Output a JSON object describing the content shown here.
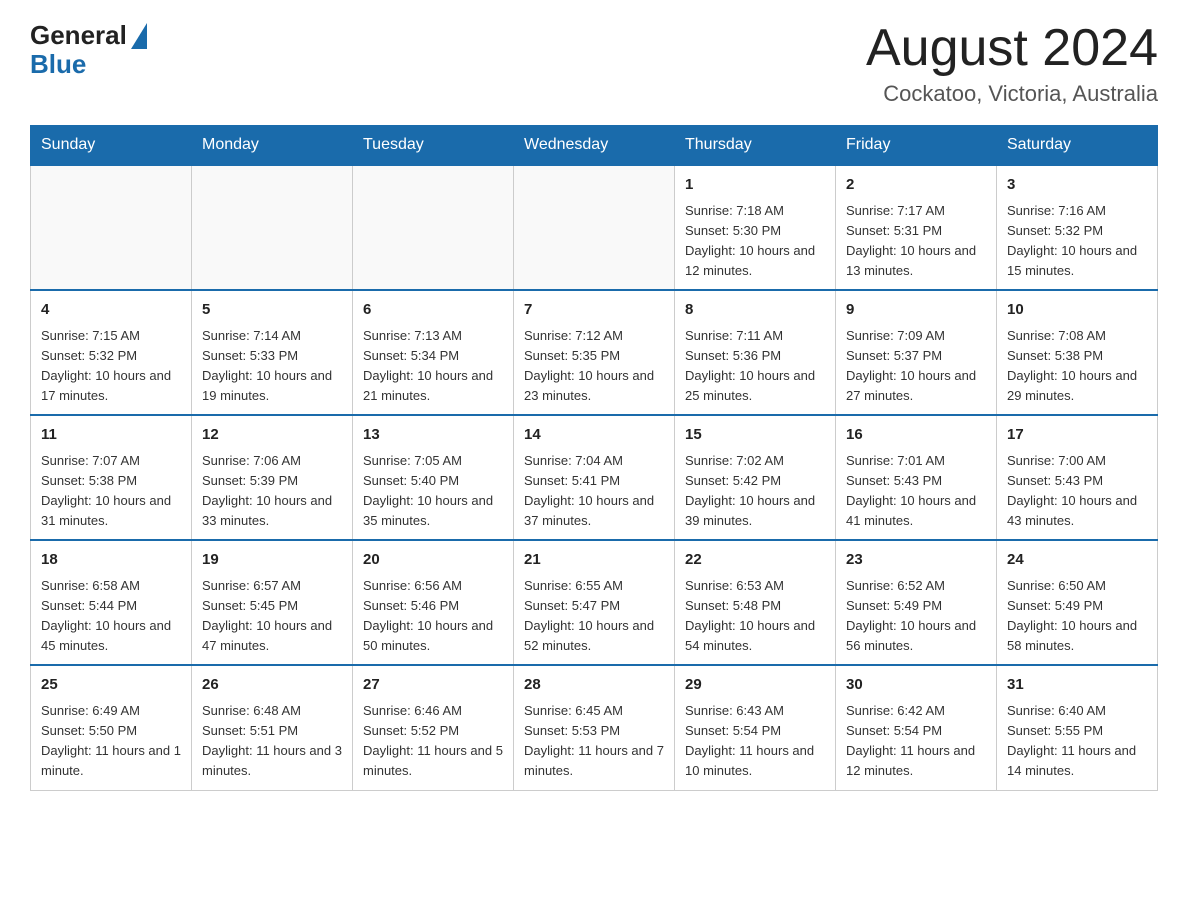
{
  "header": {
    "logo_general": "General",
    "logo_blue": "Blue",
    "month_title": "August 2024",
    "location": "Cockatoo, Victoria, Australia"
  },
  "calendar": {
    "days_of_week": [
      "Sunday",
      "Monday",
      "Tuesday",
      "Wednesday",
      "Thursday",
      "Friday",
      "Saturday"
    ],
    "weeks": [
      [
        {
          "day": "",
          "info": ""
        },
        {
          "day": "",
          "info": ""
        },
        {
          "day": "",
          "info": ""
        },
        {
          "day": "",
          "info": ""
        },
        {
          "day": "1",
          "info": "Sunrise: 7:18 AM\nSunset: 5:30 PM\nDaylight: 10 hours and 12 minutes."
        },
        {
          "day": "2",
          "info": "Sunrise: 7:17 AM\nSunset: 5:31 PM\nDaylight: 10 hours and 13 minutes."
        },
        {
          "day": "3",
          "info": "Sunrise: 7:16 AM\nSunset: 5:32 PM\nDaylight: 10 hours and 15 minutes."
        }
      ],
      [
        {
          "day": "4",
          "info": "Sunrise: 7:15 AM\nSunset: 5:32 PM\nDaylight: 10 hours and 17 minutes."
        },
        {
          "day": "5",
          "info": "Sunrise: 7:14 AM\nSunset: 5:33 PM\nDaylight: 10 hours and 19 minutes."
        },
        {
          "day": "6",
          "info": "Sunrise: 7:13 AM\nSunset: 5:34 PM\nDaylight: 10 hours and 21 minutes."
        },
        {
          "day": "7",
          "info": "Sunrise: 7:12 AM\nSunset: 5:35 PM\nDaylight: 10 hours and 23 minutes."
        },
        {
          "day": "8",
          "info": "Sunrise: 7:11 AM\nSunset: 5:36 PM\nDaylight: 10 hours and 25 minutes."
        },
        {
          "day": "9",
          "info": "Sunrise: 7:09 AM\nSunset: 5:37 PM\nDaylight: 10 hours and 27 minutes."
        },
        {
          "day": "10",
          "info": "Sunrise: 7:08 AM\nSunset: 5:38 PM\nDaylight: 10 hours and 29 minutes."
        }
      ],
      [
        {
          "day": "11",
          "info": "Sunrise: 7:07 AM\nSunset: 5:38 PM\nDaylight: 10 hours and 31 minutes."
        },
        {
          "day": "12",
          "info": "Sunrise: 7:06 AM\nSunset: 5:39 PM\nDaylight: 10 hours and 33 minutes."
        },
        {
          "day": "13",
          "info": "Sunrise: 7:05 AM\nSunset: 5:40 PM\nDaylight: 10 hours and 35 minutes."
        },
        {
          "day": "14",
          "info": "Sunrise: 7:04 AM\nSunset: 5:41 PM\nDaylight: 10 hours and 37 minutes."
        },
        {
          "day": "15",
          "info": "Sunrise: 7:02 AM\nSunset: 5:42 PM\nDaylight: 10 hours and 39 minutes."
        },
        {
          "day": "16",
          "info": "Sunrise: 7:01 AM\nSunset: 5:43 PM\nDaylight: 10 hours and 41 minutes."
        },
        {
          "day": "17",
          "info": "Sunrise: 7:00 AM\nSunset: 5:43 PM\nDaylight: 10 hours and 43 minutes."
        }
      ],
      [
        {
          "day": "18",
          "info": "Sunrise: 6:58 AM\nSunset: 5:44 PM\nDaylight: 10 hours and 45 minutes."
        },
        {
          "day": "19",
          "info": "Sunrise: 6:57 AM\nSunset: 5:45 PM\nDaylight: 10 hours and 47 minutes."
        },
        {
          "day": "20",
          "info": "Sunrise: 6:56 AM\nSunset: 5:46 PM\nDaylight: 10 hours and 50 minutes."
        },
        {
          "day": "21",
          "info": "Sunrise: 6:55 AM\nSunset: 5:47 PM\nDaylight: 10 hours and 52 minutes."
        },
        {
          "day": "22",
          "info": "Sunrise: 6:53 AM\nSunset: 5:48 PM\nDaylight: 10 hours and 54 minutes."
        },
        {
          "day": "23",
          "info": "Sunrise: 6:52 AM\nSunset: 5:49 PM\nDaylight: 10 hours and 56 minutes."
        },
        {
          "day": "24",
          "info": "Sunrise: 6:50 AM\nSunset: 5:49 PM\nDaylight: 10 hours and 58 minutes."
        }
      ],
      [
        {
          "day": "25",
          "info": "Sunrise: 6:49 AM\nSunset: 5:50 PM\nDaylight: 11 hours and 1 minute."
        },
        {
          "day": "26",
          "info": "Sunrise: 6:48 AM\nSunset: 5:51 PM\nDaylight: 11 hours and 3 minutes."
        },
        {
          "day": "27",
          "info": "Sunrise: 6:46 AM\nSunset: 5:52 PM\nDaylight: 11 hours and 5 minutes."
        },
        {
          "day": "28",
          "info": "Sunrise: 6:45 AM\nSunset: 5:53 PM\nDaylight: 11 hours and 7 minutes."
        },
        {
          "day": "29",
          "info": "Sunrise: 6:43 AM\nSunset: 5:54 PM\nDaylight: 11 hours and 10 minutes."
        },
        {
          "day": "30",
          "info": "Sunrise: 6:42 AM\nSunset: 5:54 PM\nDaylight: 11 hours and 12 minutes."
        },
        {
          "day": "31",
          "info": "Sunrise: 6:40 AM\nSunset: 5:55 PM\nDaylight: 11 hours and 14 minutes."
        }
      ]
    ]
  }
}
